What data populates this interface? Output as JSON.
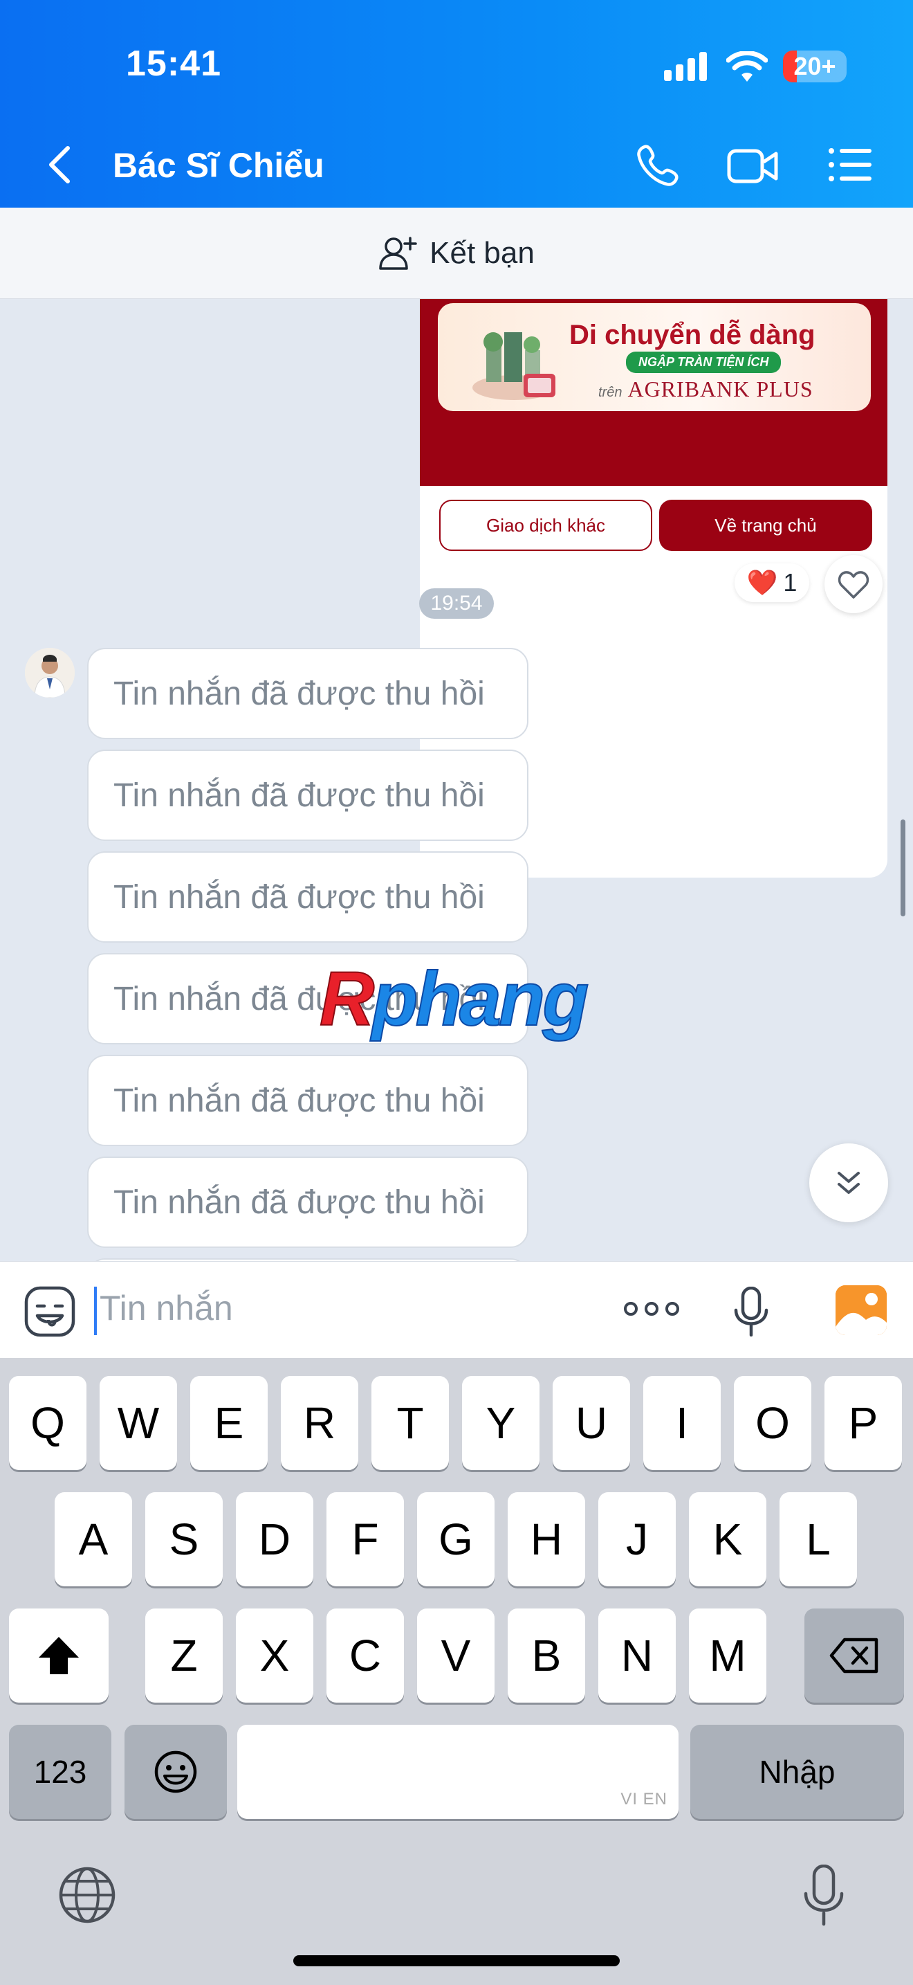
{
  "status_bar": {
    "time": "15:41",
    "battery": "20+"
  },
  "header": {
    "title": "Bác Sĩ Chiểu",
    "icons": {
      "back": "chevron-left-icon",
      "call": "phone-icon",
      "video": "video-camera-icon",
      "menu": "list-icon"
    }
  },
  "add_friend": {
    "label": "Kết bạn",
    "icon": "add-person-icon"
  },
  "receipt_card": {
    "banner_title": "Di chuyển dễ dàng",
    "banner_chip": "NGẬP TRÀN TIỆN ÍCH",
    "banner_prefix": "trên",
    "banner_brand": "AGRIBANK PLUS",
    "button_other": "Giao dịch khác",
    "button_home": "Về trang chủ",
    "accent_color": "#9b0213"
  },
  "reaction": {
    "emoji": "❤️",
    "count": "1"
  },
  "timestamp": "19:54",
  "messages": [
    {
      "text": "Tin nhắn đã được thu hồi"
    },
    {
      "text": "Tin nhắn đã được thu hồi"
    },
    {
      "text": "Tin nhắn đã được thu hồi"
    },
    {
      "text": "Tin nhắn đã được thu hồi"
    },
    {
      "text": "Tin nhắn đã được thu hồi"
    },
    {
      "text": "Tin nhắn đã được thu hồi"
    }
  ],
  "watermark": {
    "first": "R",
    "rest": "phang"
  },
  "composer": {
    "placeholder": "Tin nhắn"
  },
  "keyboard": {
    "row1": [
      "Q",
      "W",
      "E",
      "R",
      "T",
      "Y",
      "U",
      "I",
      "O",
      "P"
    ],
    "row2": [
      "A",
      "S",
      "D",
      "F",
      "G",
      "H",
      "J",
      "K",
      "L"
    ],
    "row3": [
      "Z",
      "X",
      "C",
      "V",
      "B",
      "N",
      "M"
    ],
    "numbers_key": "123",
    "return_key": "Nhập",
    "space_hint": "VI EN"
  }
}
